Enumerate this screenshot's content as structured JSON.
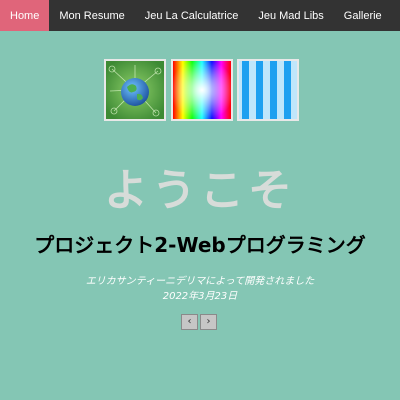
{
  "nav": {
    "items": [
      {
        "label": "Home",
        "active": true
      },
      {
        "label": "Mon Resume",
        "active": false
      },
      {
        "label": "Jeu La Calculatrice",
        "active": false
      },
      {
        "label": "Jeu Mad Libs",
        "active": false
      },
      {
        "label": "Gallerie",
        "active": false
      }
    ],
    "active_color": "#e0657a",
    "bar_color": "#333333"
  },
  "thumbnails": [
    {
      "icon": "earth-globe-image"
    },
    {
      "icon": "color-spectrum-image"
    },
    {
      "icon": "blue-stripes-image"
    }
  ],
  "hero": {
    "welcome": "ようこそ",
    "title": "プロジェクト2-Webプログラミング",
    "credit_line": "エリカサンティーニデリマによって開発されました",
    "date_line": "2022年3月23日"
  },
  "pager": {
    "prev_label": "‹",
    "next_label": "›"
  },
  "colors": {
    "background": "#84c6b4",
    "welcome_text": "#d7dcd9"
  }
}
